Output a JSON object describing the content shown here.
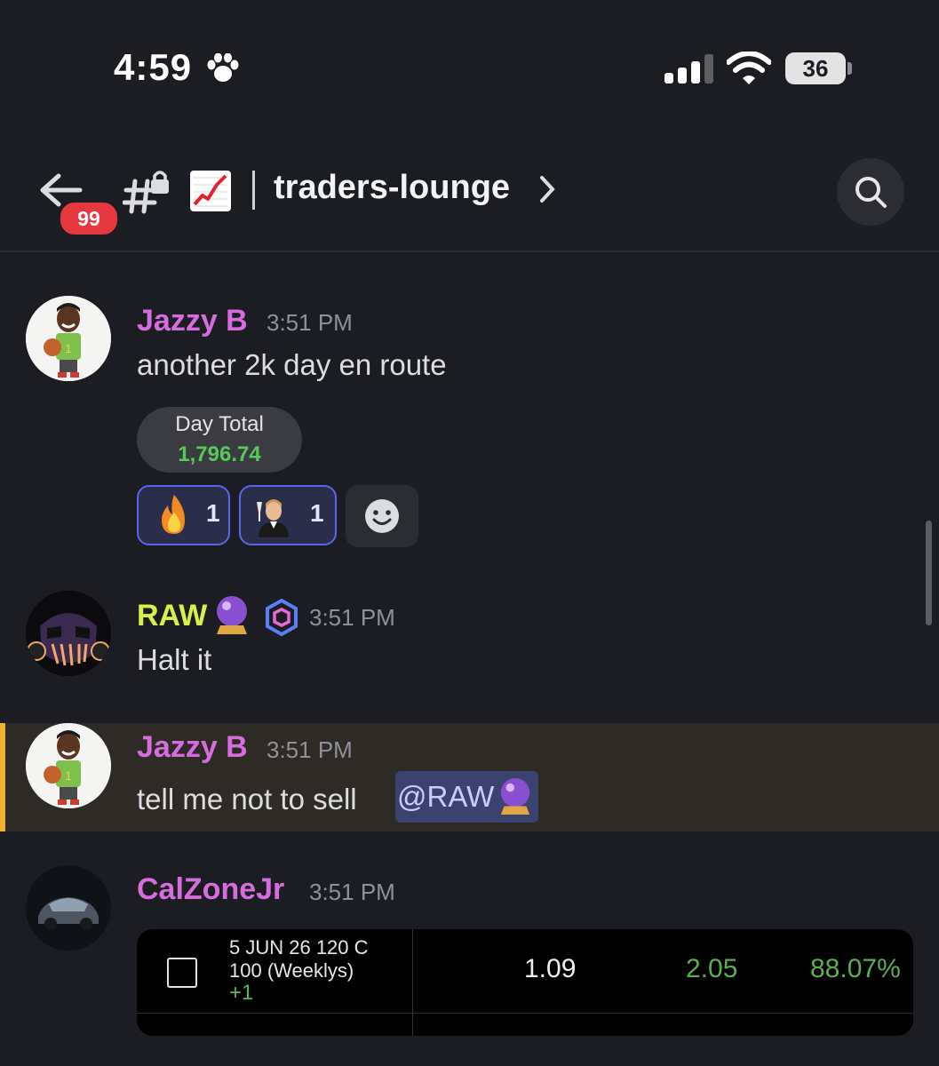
{
  "status_bar": {
    "time": "4:59",
    "battery": "36"
  },
  "header": {
    "unread_badge": "99",
    "channel_name": "traders-lounge"
  },
  "messages": [
    {
      "author": "Jazzy B",
      "author_color": "#d66ddf",
      "time": "3:51 PM",
      "text": "another 2k day en route",
      "image": {
        "label": "Day Total",
        "value": "1,796.74"
      },
      "reactions": [
        {
          "emoji": "fire-emoji",
          "count": "1"
        },
        {
          "emoji": "leo-toast-emoji",
          "count": "1"
        }
      ]
    },
    {
      "author": "RAW",
      "author_color": "#d8f04a",
      "time": "3:51 PM",
      "text": "Halt it"
    },
    {
      "author": "Jazzy B",
      "author_color": "#d66ddf",
      "time": "3:51 PM",
      "text": "tell me not to sell",
      "mention": "@RAW"
    },
    {
      "author": "CalZoneJr",
      "author_color": "#d66ddf",
      "time": "3:51 PM",
      "position_card": {
        "line1": "5 JUN 26 120 C",
        "line2": "100 (Weeklys)",
        "line3": "+1",
        "col1": "1.09",
        "col2": "2.05",
        "col3": "88.07%"
      }
    }
  ],
  "colors": {
    "background": "#1c1d23",
    "highlight": "#2e2a25",
    "highlight_bar": "#f0b232",
    "reaction_border": "#5865f2",
    "badge": "#e5393f"
  }
}
